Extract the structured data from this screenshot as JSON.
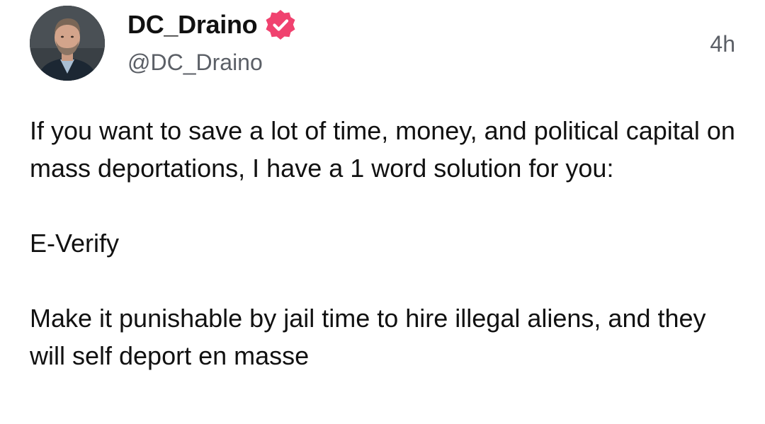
{
  "post": {
    "author": {
      "display_name": "DC_Draino",
      "handle": "@DC_Draino",
      "verified": true,
      "verified_badge_color": "#f0426f",
      "avatar_icon": "profile-photo"
    },
    "timestamp": "4h",
    "body": {
      "paragraph_1": "If you want to save a lot of time, money, and political capital on mass deportations, I have a 1 word solution for you:",
      "paragraph_2": "E-Verify",
      "paragraph_3": "Make it punishable by jail time to hire illegal aliens, and they will self deport en masse"
    }
  }
}
